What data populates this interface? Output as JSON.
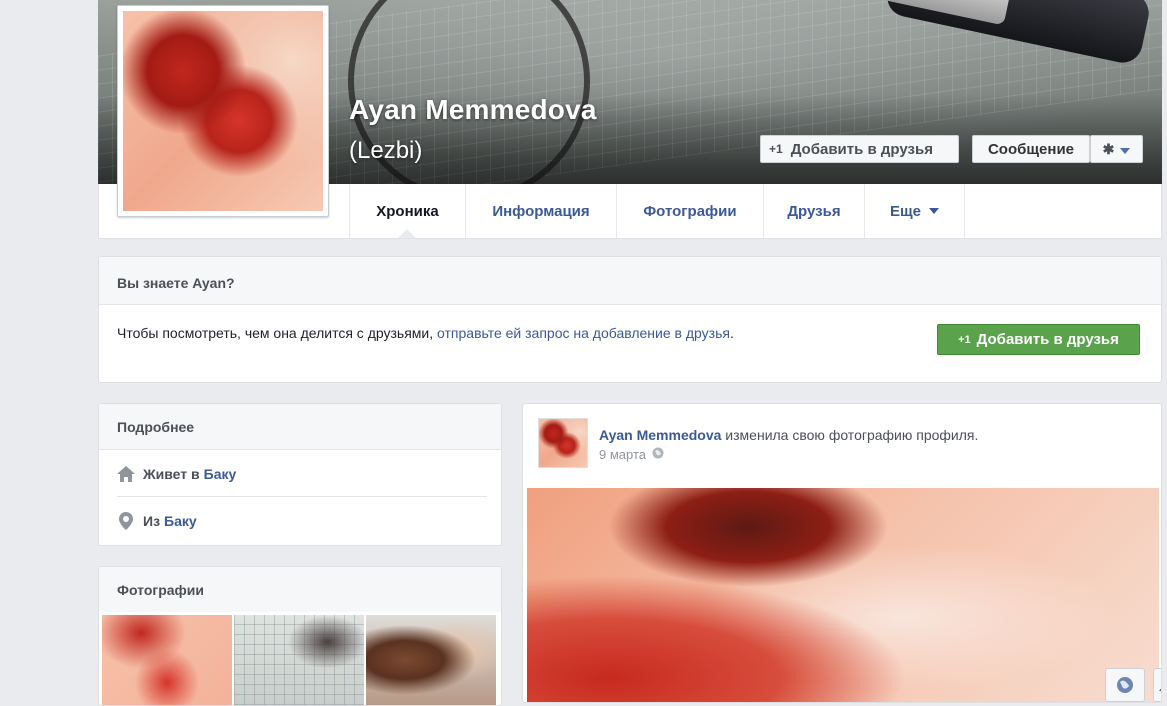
{
  "profile": {
    "name": "Ayan Memmedova",
    "alternate_name": "(Lezbi)"
  },
  "cover_actions": {
    "add_friend": "Добавить в друзья",
    "add_friend_icon": "plus-one-icon",
    "message": "Сообщение",
    "gear_icon": "gear-icon"
  },
  "tabs": [
    {
      "label": "Хроника",
      "active": true
    },
    {
      "label": "Информация"
    },
    {
      "label": "Фотографии"
    },
    {
      "label": "Друзья"
    },
    {
      "label": "Еще",
      "icon": "caret-down-icon"
    }
  ],
  "know_card": {
    "title": "Вы знаете Ayan?",
    "text_before": "Чтобы посмотреть, чем она делится с друзьями, ",
    "link_text": "отправьте ей запрос на добавление в друзья",
    "text_after": ".",
    "button": "Добавить в друзья"
  },
  "details": {
    "title": "Подробнее",
    "lives_prefix": "Живет в",
    "lives_city": "Баку",
    "from_prefix": "Из",
    "from_city": "Баку",
    "icons": [
      "home-icon",
      "location-pin-icon"
    ]
  },
  "photos": {
    "title": "Фотографии"
  },
  "post": {
    "author": "Ayan Memmedova",
    "action": " изменила свою фотографию профиля.",
    "date": "9 марта",
    "privacy_icon": "globe-icon"
  },
  "colors": {
    "link": "#3b5998",
    "green_button": "#5ba24d",
    "background": "#e9ebee"
  }
}
